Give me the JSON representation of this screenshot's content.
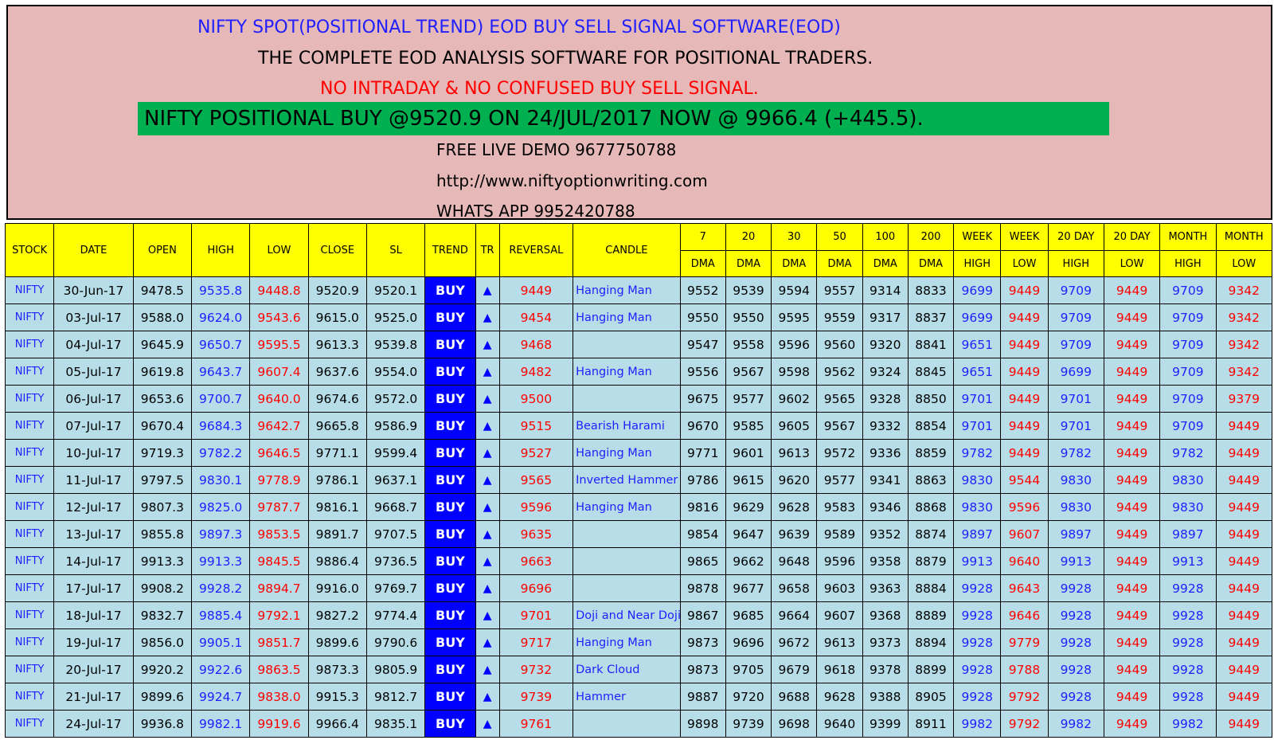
{
  "header": {
    "title": "NIFTY SPOT(POSITIONAL TREND) EOD BUY SELL SIGNAL SOFTWARE(EOD)",
    "subtitle": "THE COMPLETE EOD ANALYSIS SOFTWARE FOR POSITIONAL TRADERS.",
    "warning": "NO INTRADAY & NO CONFUSED BUY SELL SIGNAL.",
    "signal": "NIFTY POSITIONAL BUY @9520.9  ON 24/JUL/2017 NOW @ 9966.4 (+445.5).",
    "demo": "FREE LIVE DEMO 9677750788",
    "url": "http://www.niftyoptionwriting.com",
    "whatsapp": "WHATS APP 9952420788"
  },
  "columns": {
    "stock": "STOCK",
    "date": "DATE",
    "open": "OPEN",
    "high": "HIGH",
    "low": "LOW",
    "close": "CLOSE",
    "sl": "SL",
    "trend": "TREND",
    "tr": "TR",
    "reversal": "REVERSAL",
    "candle": "CANDLE",
    "dma7": "7",
    "dma20": "20",
    "dma30": "30",
    "dma50": "50",
    "dma100": "100",
    "dma200": "200",
    "dma_sub": "DMA",
    "week_high_top": "WEEK",
    "week_high_bot": "HIGH",
    "week_low_top": "WEEK",
    "week_low_bot": "LOW",
    "d20_high_top": "20 DAY",
    "d20_high_bot": "HIGH",
    "d20_low_top": "20 DAY",
    "d20_low_bot": "LOW",
    "month_high_top": "MONTH",
    "month_high_bot": "HIGH",
    "month_low_top": "MONTH",
    "month_low_bot": "LOW"
  },
  "rows": [
    [
      "NIFTY",
      "30-Jun-17",
      "9478.5",
      "9535.8",
      "9448.8",
      "9520.9",
      "9520.1",
      "BUY",
      "▲",
      "9449",
      "Hanging Man",
      "9552",
      "9539",
      "9594",
      "9557",
      "9314",
      "8833",
      "9699",
      "9449",
      "9709",
      "9449",
      "9709",
      "9342"
    ],
    [
      "NIFTY",
      "03-Jul-17",
      "9588.0",
      "9624.0",
      "9543.6",
      "9615.0",
      "9525.0",
      "BUY",
      "▲",
      "9454",
      "Hanging Man",
      "9550",
      "9550",
      "9595",
      "9559",
      "9317",
      "8837",
      "9699",
      "9449",
      "9709",
      "9449",
      "9709",
      "9342"
    ],
    [
      "NIFTY",
      "04-Jul-17",
      "9645.9",
      "9650.7",
      "9595.5",
      "9613.3",
      "9539.8",
      "BUY",
      "▲",
      "9468",
      "",
      "9547",
      "9558",
      "9596",
      "9560",
      "9320",
      "8841",
      "9651",
      "9449",
      "9709",
      "9449",
      "9709",
      "9342"
    ],
    [
      "NIFTY",
      "05-Jul-17",
      "9619.8",
      "9643.7",
      "9607.4",
      "9637.6",
      "9554.0",
      "BUY",
      "▲",
      "9482",
      "Hanging Man",
      "9556",
      "9567",
      "9598",
      "9562",
      "9324",
      "8845",
      "9651",
      "9449",
      "9699",
      "9449",
      "9709",
      "9342"
    ],
    [
      "NIFTY",
      "06-Jul-17",
      "9653.6",
      "9700.7",
      "9640.0",
      "9674.6",
      "9572.0",
      "BUY",
      "▲",
      "9500",
      "",
      "9675",
      "9577",
      "9602",
      "9565",
      "9328",
      "8850",
      "9701",
      "9449",
      "9701",
      "9449",
      "9709",
      "9379"
    ],
    [
      "NIFTY",
      "07-Jul-17",
      "9670.4",
      "9684.3",
      "9642.7",
      "9665.8",
      "9586.9",
      "BUY",
      "▲",
      "9515",
      "Bearish Harami",
      "9670",
      "9585",
      "9605",
      "9567",
      "9332",
      "8854",
      "9701",
      "9449",
      "9701",
      "9449",
      "9709",
      "9449"
    ],
    [
      "NIFTY",
      "10-Jul-17",
      "9719.3",
      "9782.2",
      "9646.5",
      "9771.1",
      "9599.4",
      "BUY",
      "▲",
      "9527",
      "Hanging Man",
      "9771",
      "9601",
      "9613",
      "9572",
      "9336",
      "8859",
      "9782",
      "9449",
      "9782",
      "9449",
      "9782",
      "9449"
    ],
    [
      "NIFTY",
      "11-Jul-17",
      "9797.5",
      "9830.1",
      "9778.9",
      "9786.1",
      "9637.1",
      "BUY",
      "▲",
      "9565",
      "Inverted Hammer",
      "9786",
      "9615",
      "9620",
      "9577",
      "9341",
      "8863",
      "9830",
      "9544",
      "9830",
      "9449",
      "9830",
      "9449"
    ],
    [
      "NIFTY",
      "12-Jul-17",
      "9807.3",
      "9825.0",
      "9787.7",
      "9816.1",
      "9668.7",
      "BUY",
      "▲",
      "9596",
      "Hanging Man",
      "9816",
      "9629",
      "9628",
      "9583",
      "9346",
      "8868",
      "9830",
      "9596",
      "9830",
      "9449",
      "9830",
      "9449"
    ],
    [
      "NIFTY",
      "13-Jul-17",
      "9855.8",
      "9897.3",
      "9853.5",
      "9891.7",
      "9707.5",
      "BUY",
      "▲",
      "9635",
      "",
      "9854",
      "9647",
      "9639",
      "9589",
      "9352",
      "8874",
      "9897",
      "9607",
      "9897",
      "9449",
      "9897",
      "9449"
    ],
    [
      "NIFTY",
      "14-Jul-17",
      "9913.3",
      "9913.3",
      "9845.5",
      "9886.4",
      "9736.5",
      "BUY",
      "▲",
      "9663",
      "",
      "9865",
      "9662",
      "9648",
      "9596",
      "9358",
      "8879",
      "9913",
      "9640",
      "9913",
      "9449",
      "9913",
      "9449"
    ],
    [
      "NIFTY",
      "17-Jul-17",
      "9908.2",
      "9928.2",
      "9894.7",
      "9916.0",
      "9769.7",
      "BUY",
      "▲",
      "9696",
      "",
      "9878",
      "9677",
      "9658",
      "9603",
      "9363",
      "8884",
      "9928",
      "9643",
      "9928",
      "9449",
      "9928",
      "9449"
    ],
    [
      "NIFTY",
      "18-Jul-17",
      "9832.7",
      "9885.4",
      "9792.1",
      "9827.2",
      "9774.4",
      "BUY",
      "▲",
      "9701",
      "Doji and Near Doji",
      "9867",
      "9685",
      "9664",
      "9607",
      "9368",
      "8889",
      "9928",
      "9646",
      "9928",
      "9449",
      "9928",
      "9449"
    ],
    [
      "NIFTY",
      "19-Jul-17",
      "9856.0",
      "9905.1",
      "9851.7",
      "9899.6",
      "9790.6",
      "BUY",
      "▲",
      "9717",
      "Hanging Man",
      "9873",
      "9696",
      "9672",
      "9613",
      "9373",
      "8894",
      "9928",
      "9779",
      "9928",
      "9449",
      "9928",
      "9449"
    ],
    [
      "NIFTY",
      "20-Jul-17",
      "9920.2",
      "9922.6",
      "9863.5",
      "9873.3",
      "9805.9",
      "BUY",
      "▲",
      "9732",
      "Dark Cloud",
      "9873",
      "9705",
      "9679",
      "9618",
      "9378",
      "8899",
      "9928",
      "9788",
      "9928",
      "9449",
      "9928",
      "9449"
    ],
    [
      "NIFTY",
      "21-Jul-17",
      "9899.6",
      "9924.7",
      "9838.0",
      "9915.3",
      "9812.7",
      "BUY",
      "▲",
      "9739",
      "Hammer",
      "9887",
      "9720",
      "9688",
      "9628",
      "9388",
      "8905",
      "9928",
      "9792",
      "9928",
      "9449",
      "9928",
      "9449"
    ],
    [
      "NIFTY",
      "24-Jul-17",
      "9936.8",
      "9982.1",
      "9919.6",
      "9966.4",
      "9835.1",
      "BUY",
      "▲",
      "9761",
      "",
      "9898",
      "9739",
      "9698",
      "9640",
      "9399",
      "8911",
      "9982",
      "9792",
      "9982",
      "9449",
      "9982",
      "9449"
    ]
  ]
}
